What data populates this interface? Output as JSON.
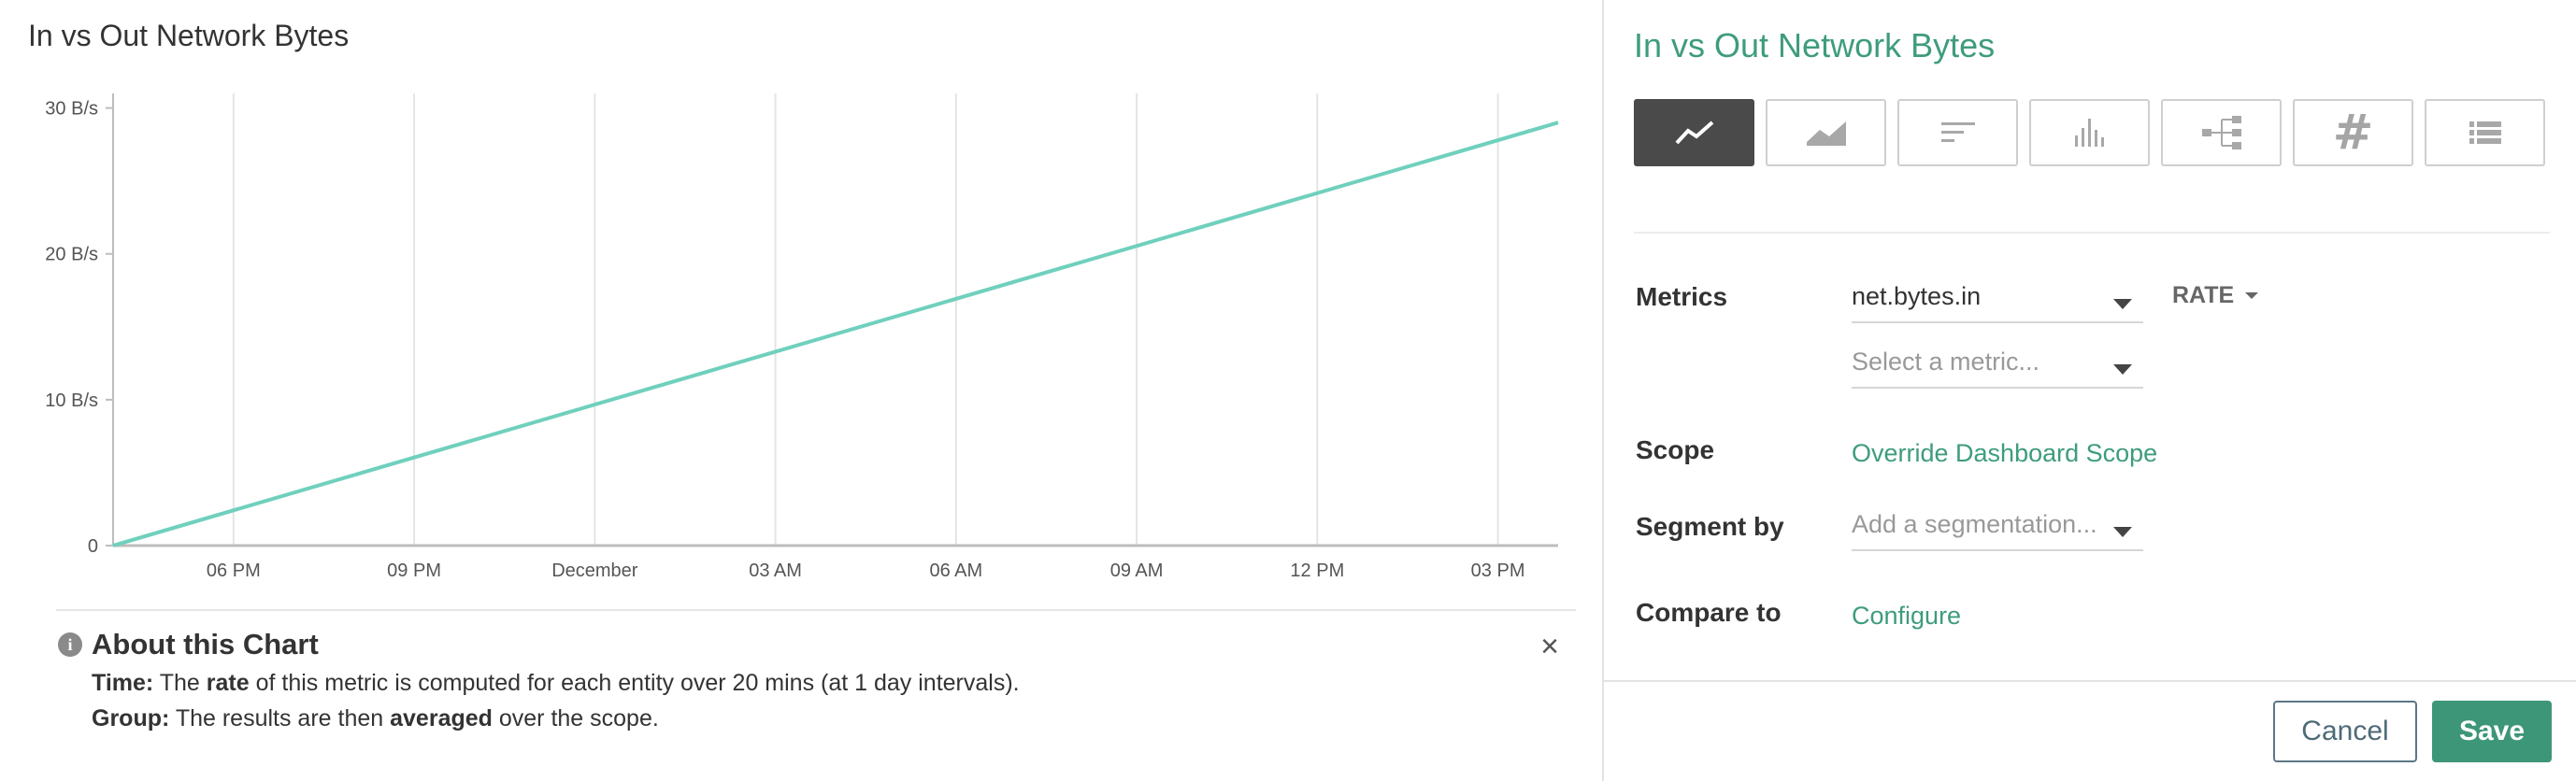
{
  "chart_panel": {
    "title": "In vs Out Network Bytes",
    "about": {
      "title": "About this Chart",
      "time_label": "Time:",
      "time_pre": "The",
      "time_bold": "rate",
      "time_post": "of this metric is computed for each entity over 20 mins (at 1 day intervals).",
      "group_label": "Group:",
      "group_pre": "The results are then",
      "group_bold": "averaged",
      "group_post": "over the scope.",
      "close_glyph": "×"
    }
  },
  "chart_data": {
    "type": "line",
    "title": "In vs Out Network Bytes",
    "xlabel": "",
    "ylabel": "",
    "x_ticks": [
      "06 PM",
      "09 PM",
      "December",
      "03 AM",
      "06 AM",
      "09 AM",
      "12 PM",
      "03 PM"
    ],
    "x": [
      0,
      24
    ],
    "xlim": [
      0,
      24
    ],
    "x_tick_positions": [
      2,
      5,
      8,
      11,
      14,
      17,
      20,
      23
    ],
    "y_ticks": [
      0,
      10,
      20,
      30
    ],
    "y_tick_labels": [
      "0",
      "10 B/s",
      "20 B/s",
      "30 B/s"
    ],
    "ylim": [
      0,
      31
    ],
    "grid": "vertical",
    "series": [
      {
        "values": [
          0,
          29
        ],
        "color": "#6fd0bd"
      }
    ]
  },
  "config_panel": {
    "title": "In vs Out Network Bytes",
    "viz_types": [
      {
        "icon": "line-chart-icon",
        "active": true
      },
      {
        "icon": "area-chart-icon",
        "active": false
      },
      {
        "icon": "horizontal-bar-icon",
        "active": false
      },
      {
        "icon": "column-chart-icon",
        "active": false
      },
      {
        "icon": "tree-icon",
        "active": false
      },
      {
        "icon": "hash-icon",
        "active": false,
        "glyph": "#"
      },
      {
        "icon": "table-list-icon",
        "active": false
      }
    ],
    "metrics_label": "Metrics",
    "metric_value": "net.bytes.in",
    "metric_placeholder": "Select a metric...",
    "rate_label": "RATE",
    "scope_label": "Scope",
    "scope_link": "Override Dashboard Scope",
    "segment_label": "Segment by",
    "segment_placeholder": "Add a segmentation...",
    "compare_label": "Compare to",
    "compare_link": "Configure",
    "cancel_label": "Cancel",
    "save_label": "Save"
  },
  "colors": {
    "accent": "#3e9c7c",
    "save_button": "#3d9678",
    "line": "#6fd0bd",
    "active_viz": "#4a4a4a"
  }
}
